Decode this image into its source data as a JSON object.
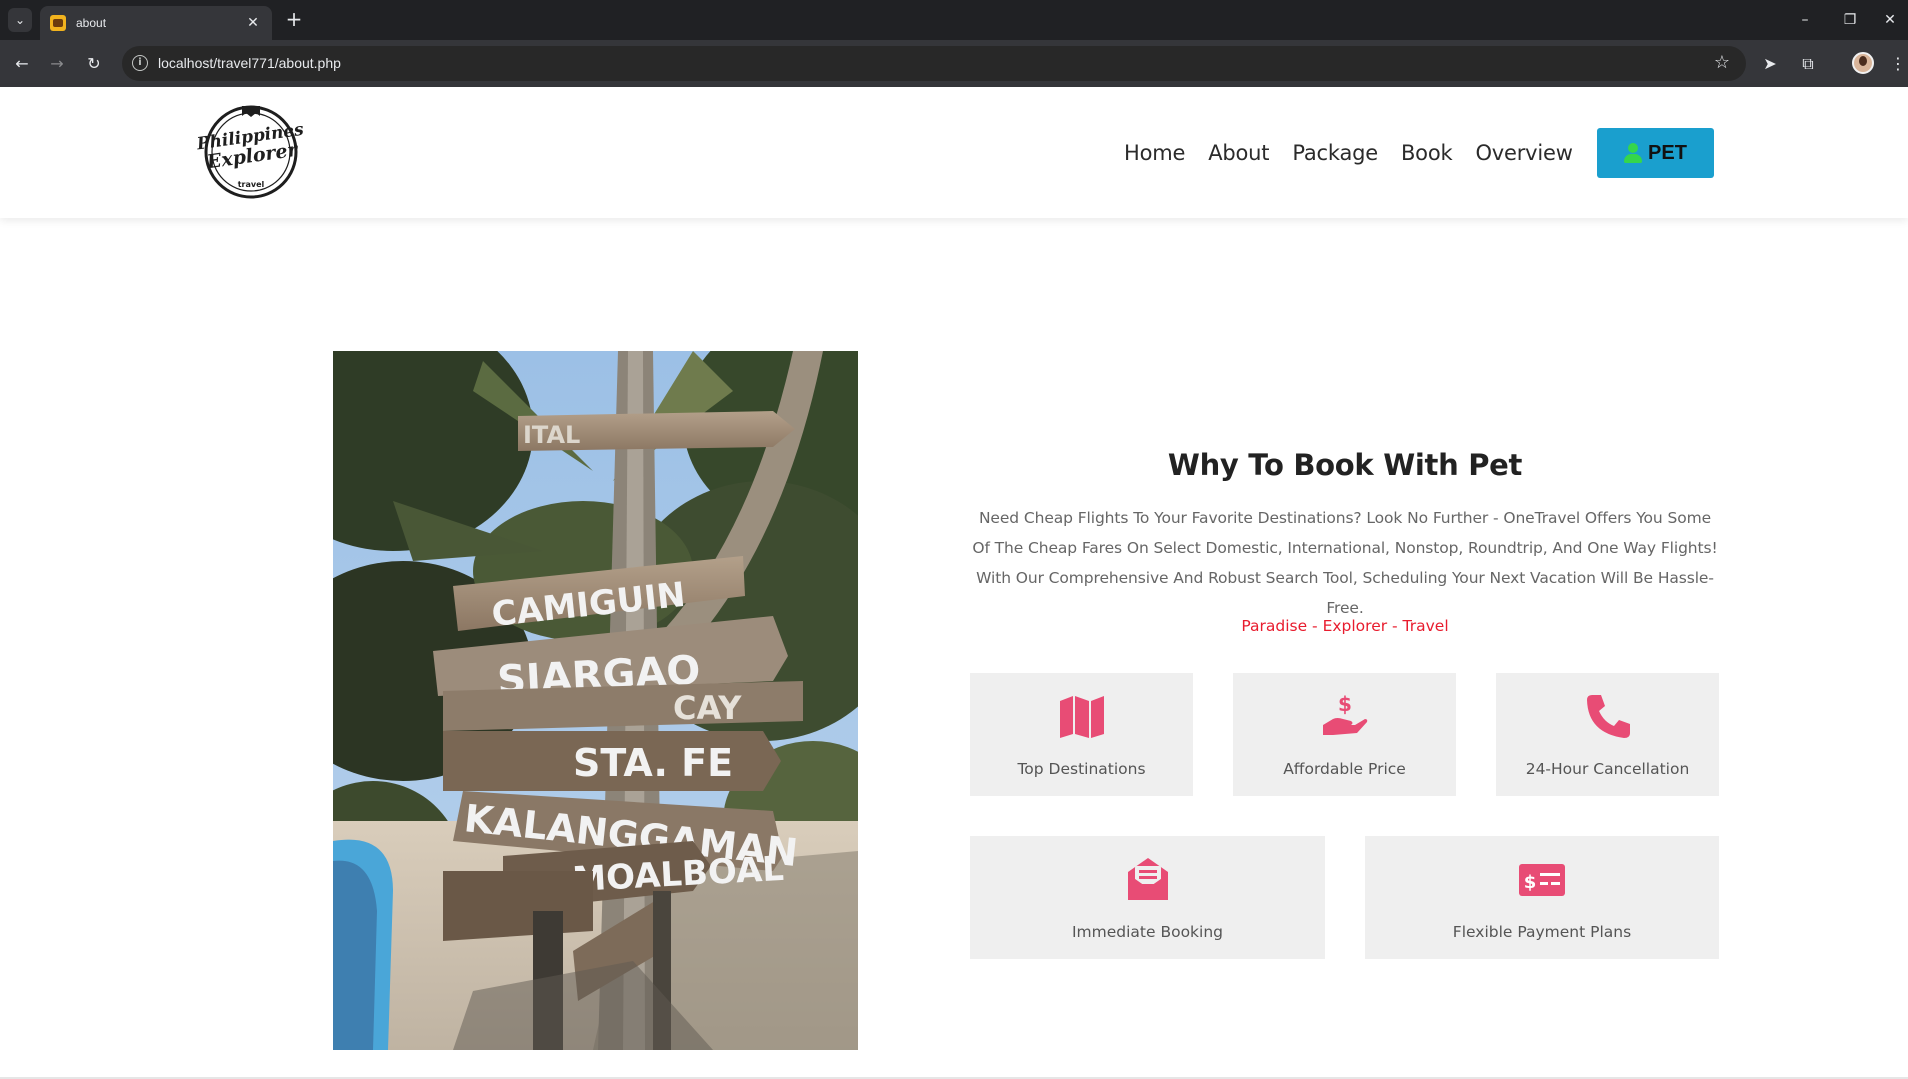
{
  "browser": {
    "tab_title": "about",
    "url": "localhost/travel771/about.php"
  },
  "header": {
    "logo": {
      "line1": "Philippines",
      "line2": "Explorer",
      "line3": "travel"
    },
    "nav": [
      "Home",
      "About",
      "Package",
      "Book",
      "Overview"
    ],
    "cta_label": "PET"
  },
  "about": {
    "heading": "Why To Book With Pet",
    "paragraph": "Need Cheap Flights To Your Favorite Destinations? Look No Further - OneTravel Offers You Some Of The Cheap Fares On Select Domestic, International, Nonstop, Roundtrip, And One Way Flights! With Our Comprehensive And Robust Search Tool, Scheduling Your Next Vacation Will Be Hassle-Free.",
    "tagline": "Paradise - Explorer - Travel",
    "features": [
      {
        "label": "Top Destinations",
        "icon": "map-icon"
      },
      {
        "label": "Affordable Price",
        "icon": "hand-dollar-icon"
      },
      {
        "label": "24-Hour Cancellation",
        "icon": "phone-icon"
      },
      {
        "label": "Immediate Booking",
        "icon": "envelope-open-icon"
      },
      {
        "label": "Flexible Payment Plans",
        "icon": "money-check-icon"
      }
    ]
  },
  "photo": {
    "signs": [
      "ITAL",
      "CAMIGUIN",
      "SIARGAO",
      "CAY",
      "STA. FE",
      "KALANGGAMAN",
      "MOALBOAL"
    ]
  },
  "colors": {
    "accent": "#1a9fce",
    "icon_pink": "#e84c75",
    "tagline_red": "#e81c2e",
    "card_bg": "#efefef"
  }
}
